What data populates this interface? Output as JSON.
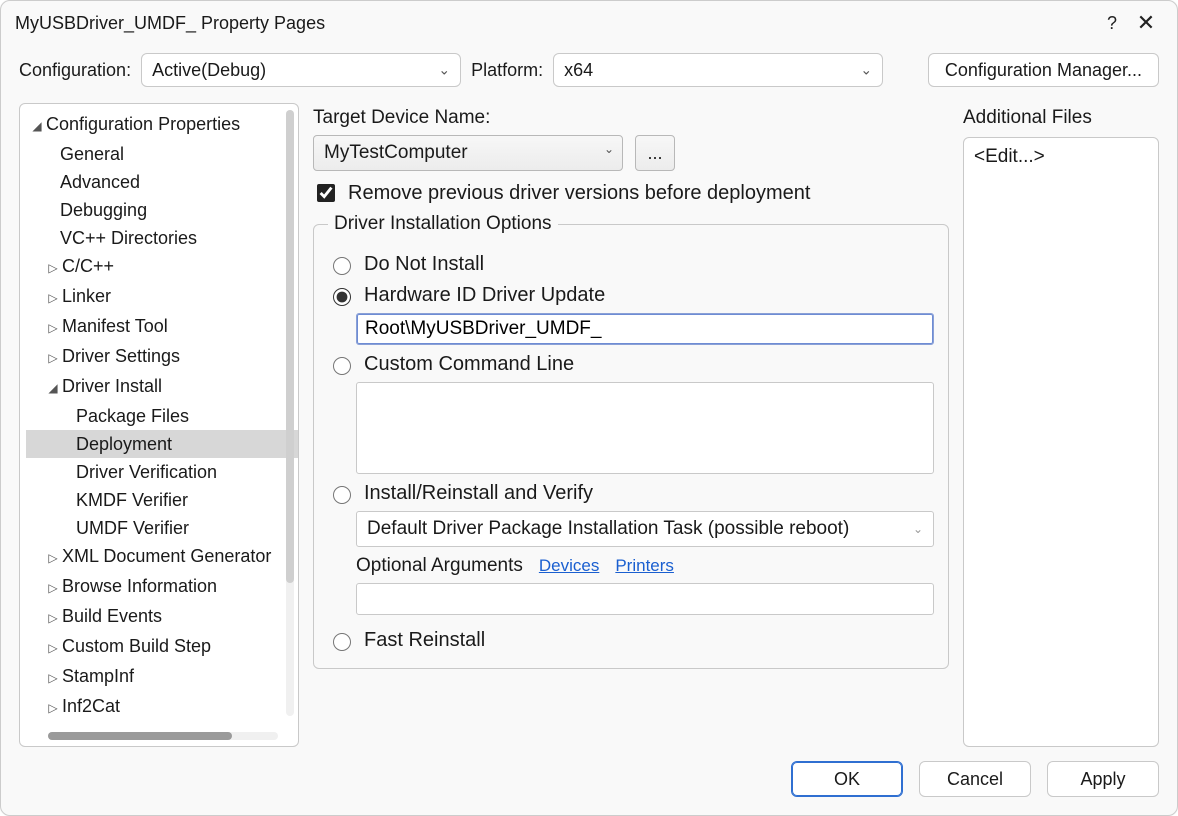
{
  "window": {
    "title": "MyUSBDriver_UMDF_ Property Pages",
    "help_icon": "?",
    "close_icon": "✕"
  },
  "toprow": {
    "configuration_label": "Configuration:",
    "configuration_value": "Active(Debug)",
    "platform_label": "Platform:",
    "platform_value": "x64",
    "config_manager_label": "Configuration Manager..."
  },
  "tree": {
    "root": "Configuration Properties",
    "items": [
      {
        "label": "General",
        "level": 2
      },
      {
        "label": "Advanced",
        "level": 2
      },
      {
        "label": "Debugging",
        "level": 2
      },
      {
        "label": "VC++ Directories",
        "level": 2
      },
      {
        "label": "C/C++",
        "level": 2,
        "toggle": "▷"
      },
      {
        "label": "Linker",
        "level": 2,
        "toggle": "▷"
      },
      {
        "label": "Manifest Tool",
        "level": 2,
        "toggle": "▷"
      },
      {
        "label": "Driver Settings",
        "level": 2,
        "toggle": "▷"
      },
      {
        "label": "Driver Install",
        "level": 2,
        "toggle": "◢"
      },
      {
        "label": "Package Files",
        "level": 3
      },
      {
        "label": "Deployment",
        "level": 3,
        "selected": true
      },
      {
        "label": "Driver Verification",
        "level": 3
      },
      {
        "label": "KMDF Verifier",
        "level": 3
      },
      {
        "label": "UMDF Verifier",
        "level": 3
      },
      {
        "label": "XML Document Generator",
        "level": 2,
        "toggle": "▷"
      },
      {
        "label": "Browse Information",
        "level": 2,
        "toggle": "▷"
      },
      {
        "label": "Build Events",
        "level": 2,
        "toggle": "▷"
      },
      {
        "label": "Custom Build Step",
        "level": 2,
        "toggle": "▷"
      },
      {
        "label": "StampInf",
        "level": 2,
        "toggle": "▷"
      },
      {
        "label": "Inf2Cat",
        "level": 2,
        "toggle": "▷"
      }
    ]
  },
  "center": {
    "target_label": "Target Device Name:",
    "target_value": "MyTestComputer",
    "browse_label": "...",
    "remove_prev_label": "Remove previous driver versions before deployment",
    "remove_prev_checked": true,
    "group_legend": "Driver Installation Options",
    "opt_do_not_install": "Do Not Install",
    "opt_hwid": "Hardware ID Driver Update",
    "hwid_value": "Root\\MyUSBDriver_UMDF_",
    "opt_custom": "Custom Command Line",
    "custom_value": "",
    "opt_install_verify": "Install/Reinstall and Verify",
    "install_task_value": "Default Driver Package Installation Task (possible reboot)",
    "optional_args_label": "Optional Arguments",
    "link_devices": "Devices",
    "link_printers": "Printers",
    "optional_args_value": "",
    "opt_fast": "Fast Reinstall"
  },
  "right": {
    "label": "Additional Files",
    "edit_item": "<Edit...>"
  },
  "footer": {
    "ok": "OK",
    "cancel": "Cancel",
    "apply": "Apply"
  }
}
